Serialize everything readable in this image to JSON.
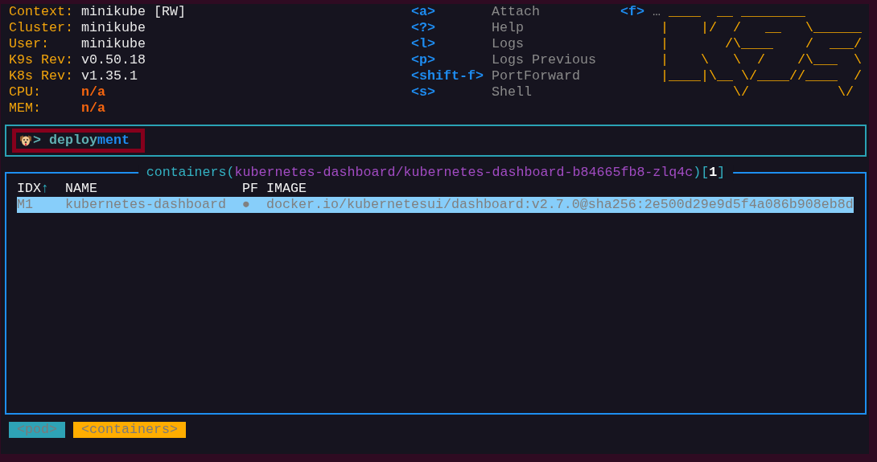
{
  "cluster_info": [
    {
      "label": "Context:",
      "value": "minikube [RW]",
      "kind": "info"
    },
    {
      "label": "Cluster:",
      "value": "minikube",
      "kind": "info"
    },
    {
      "label": "User:",
      "value": "minikube",
      "kind": "info"
    },
    {
      "label": "K9s Rev:",
      "value": "v0.50.18",
      "kind": "info"
    },
    {
      "label": "K8s Rev:",
      "value": "v1.35.1",
      "kind": "info"
    },
    {
      "label": "CPU:",
      "value": "n/a",
      "kind": "warning"
    },
    {
      "label": "MEM:",
      "value": "n/a",
      "kind": "warning"
    }
  ],
  "key_hint_columns": [
    {
      "hints": [
        {
          "key": "<a>",
          "action": "Attach"
        },
        {
          "key": "<?>",
          "action": "Help"
        },
        {
          "key": "<l>",
          "action": "Logs"
        },
        {
          "key": "<p>",
          "action": "Logs Previous"
        },
        {
          "key": "<shift-f>",
          "action": "PortForward"
        },
        {
          "key": "<s>",
          "action": "Shell"
        }
      ]
    },
    {
      "hints": [
        {
          "key": "<f>",
          "action": "…"
        }
      ]
    }
  ],
  "logo": {
    "lines": [
      " ____  __ ________",
      "|    |/  /   __   \\______",
      "|       /\\____    /  ___/",
      "|    \\   \\  /    /\\___  \\",
      "|____|\\__ \\/____//____  /",
      "         \\/           \\/"
    ]
  },
  "command_prompt": {
    "prompt": ">",
    "input": "deploy",
    "suggestion": "ment"
  },
  "table": {
    "title": [
      {
        "text": "containers",
        "kind": "resource"
      },
      {
        "text": "(",
        "kind": "punct"
      },
      {
        "text": "kubernetes-dashboard/kubernetes-dashboard-b84665fb8-zlq4c",
        "kind": "path"
      },
      {
        "text": ")",
        "kind": "punct"
      },
      {
        "text": "[",
        "kind": "punct"
      },
      {
        "text": "1",
        "kind": "count"
      },
      {
        "text": "]",
        "kind": "punct"
      }
    ],
    "columns": [
      {
        "label": "IDX",
        "sort_arrow": "↑"
      },
      {
        "label": "NAME"
      },
      {
        "label": "PF"
      },
      {
        "label": "IMAGE"
      }
    ],
    "rows": [
      {
        "selected": true,
        "cells": [
          "M1",
          "kubernetes-dashboard",
          "●",
          "docker.io/kubernetesui/dashboard:v2.7.0@sha256:2e500d29e9d5f4a086b908eb8d"
        ]
      }
    ]
  },
  "breadcrumbs": [
    {
      "label": "<pod>",
      "selected": false
    },
    {
      "label": "<containers>",
      "selected": true
    }
  ]
}
